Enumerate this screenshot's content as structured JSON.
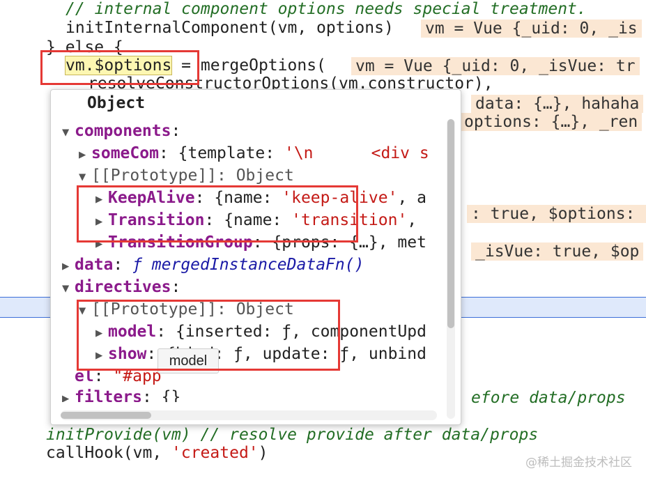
{
  "code": {
    "comment_internal": "// internal component options needs special treatment.",
    "init_internal": "initInternalComponent(vm, options)",
    "else_line": "} else {",
    "options_assign_word": "vm.$options",
    "options_assign_rest": " = mergeOptions(",
    "resolve_line": "resolveConstructorOptions(vm.constructor),",
    "init_provide": "initProvide(vm) // resolve provide after data/props",
    "before_data_comment": "efore data/props",
    "callhook_fn": "callHook(vm, ",
    "callhook_str": "'created'",
    "callhook_end": ")"
  },
  "hints": {
    "hint1": "vm = Vue {_uid: 0, _is",
    "hint2": "vm = Vue {_uid: 0, _isVue: tr",
    "hint3": "data: {…}, hahaha",
    "hint4": "options: {…}, _ren",
    "hint5": ": true, $options: ",
    "hint6": "_isVue: true, $op"
  },
  "popover": {
    "title": "Object",
    "rows": {
      "components": "components",
      "someCom_key": "someCom",
      "someCom_val": "{template: ",
      "someCom_str": "'\\n      <div s",
      "proto1": "[[Prototype]]: Object",
      "keepalive_key": "KeepAlive",
      "keepalive_val": "{name: ",
      "keepalive_str": "'keep-alive'",
      "keepalive_rest": ", a",
      "transition_key": "Transition",
      "transition_val": "{name: ",
      "transition_str": "'transition'",
      "transition_rest": ",",
      "transitiongroup_key": "TransitionGroup",
      "transitiongroup_val": "{props: {…}, met",
      "data_key": "data",
      "data_fn": "ƒ mergedInstanceDataFn()",
      "directives": "directives",
      "proto2": "[[Prototype]]: Object",
      "model_key": "model",
      "model_val": "{inserted: ƒ, componentUpd",
      "show_key": "show",
      "show_val": "{bind: ƒ, update: ƒ, unbind",
      "el_key": "el",
      "el_str": "\"#app",
      "filters_key": "filters",
      "filters_val": "{}"
    }
  },
  "tooltip": "model",
  "watermark": "@稀土掘金技术社区",
  "colors": {
    "annotation_red": "#e53935",
    "hint_bg": "#fbe7d3",
    "highlight_line": "#dfe9fb"
  }
}
